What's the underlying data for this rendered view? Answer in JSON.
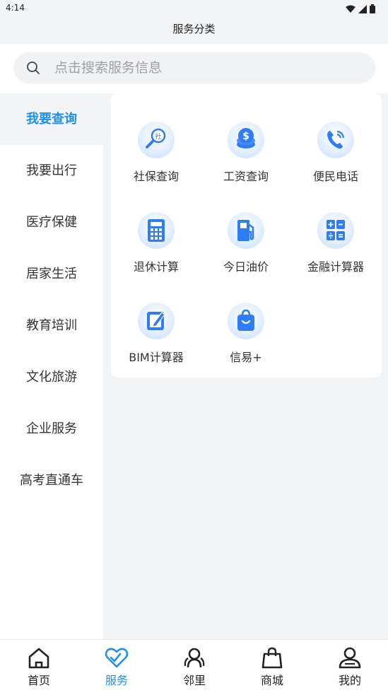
{
  "status_bar": {
    "time": "4:14"
  },
  "header": {
    "title": "服务分类"
  },
  "search": {
    "placeholder": "点击搜索服务信息"
  },
  "sidebar": {
    "items": [
      {
        "label": "我要查询",
        "active": true
      },
      {
        "label": "我要出行"
      },
      {
        "label": "医疗保健"
      },
      {
        "label": "居家生活"
      },
      {
        "label": "教育培训"
      },
      {
        "label": "文化旅游"
      },
      {
        "label": "企业服务"
      },
      {
        "label": "高考直通车"
      }
    ]
  },
  "services": [
    {
      "label": "社保查询",
      "icon": "social-security-search-icon"
    },
    {
      "label": "工资查询",
      "icon": "salary-coin-icon"
    },
    {
      "label": "便民电话",
      "icon": "phone-icon"
    },
    {
      "label": "退休计算",
      "icon": "calculator-icon"
    },
    {
      "label": "今日油价",
      "icon": "gas-pump-icon"
    },
    {
      "label": "金融计算器",
      "icon": "finance-calculator-icon"
    },
    {
      "label": "BIM计算器",
      "icon": "edit-note-icon"
    },
    {
      "label": "信易+",
      "icon": "shopping-bag-icon"
    }
  ],
  "tabbar": {
    "items": [
      {
        "label": "首页",
        "icon": "home-icon"
      },
      {
        "label": "服务",
        "icon": "service-heart-icon",
        "active": true
      },
      {
        "label": "邻里",
        "icon": "neighbors-icon"
      },
      {
        "label": "商城",
        "icon": "shop-bag-icon"
      },
      {
        "label": "我的",
        "icon": "profile-icon"
      }
    ]
  },
  "colors": {
    "accent": "#1f8ff0",
    "background": "#f3f4f6",
    "icon_blue": "#2f7df6"
  }
}
